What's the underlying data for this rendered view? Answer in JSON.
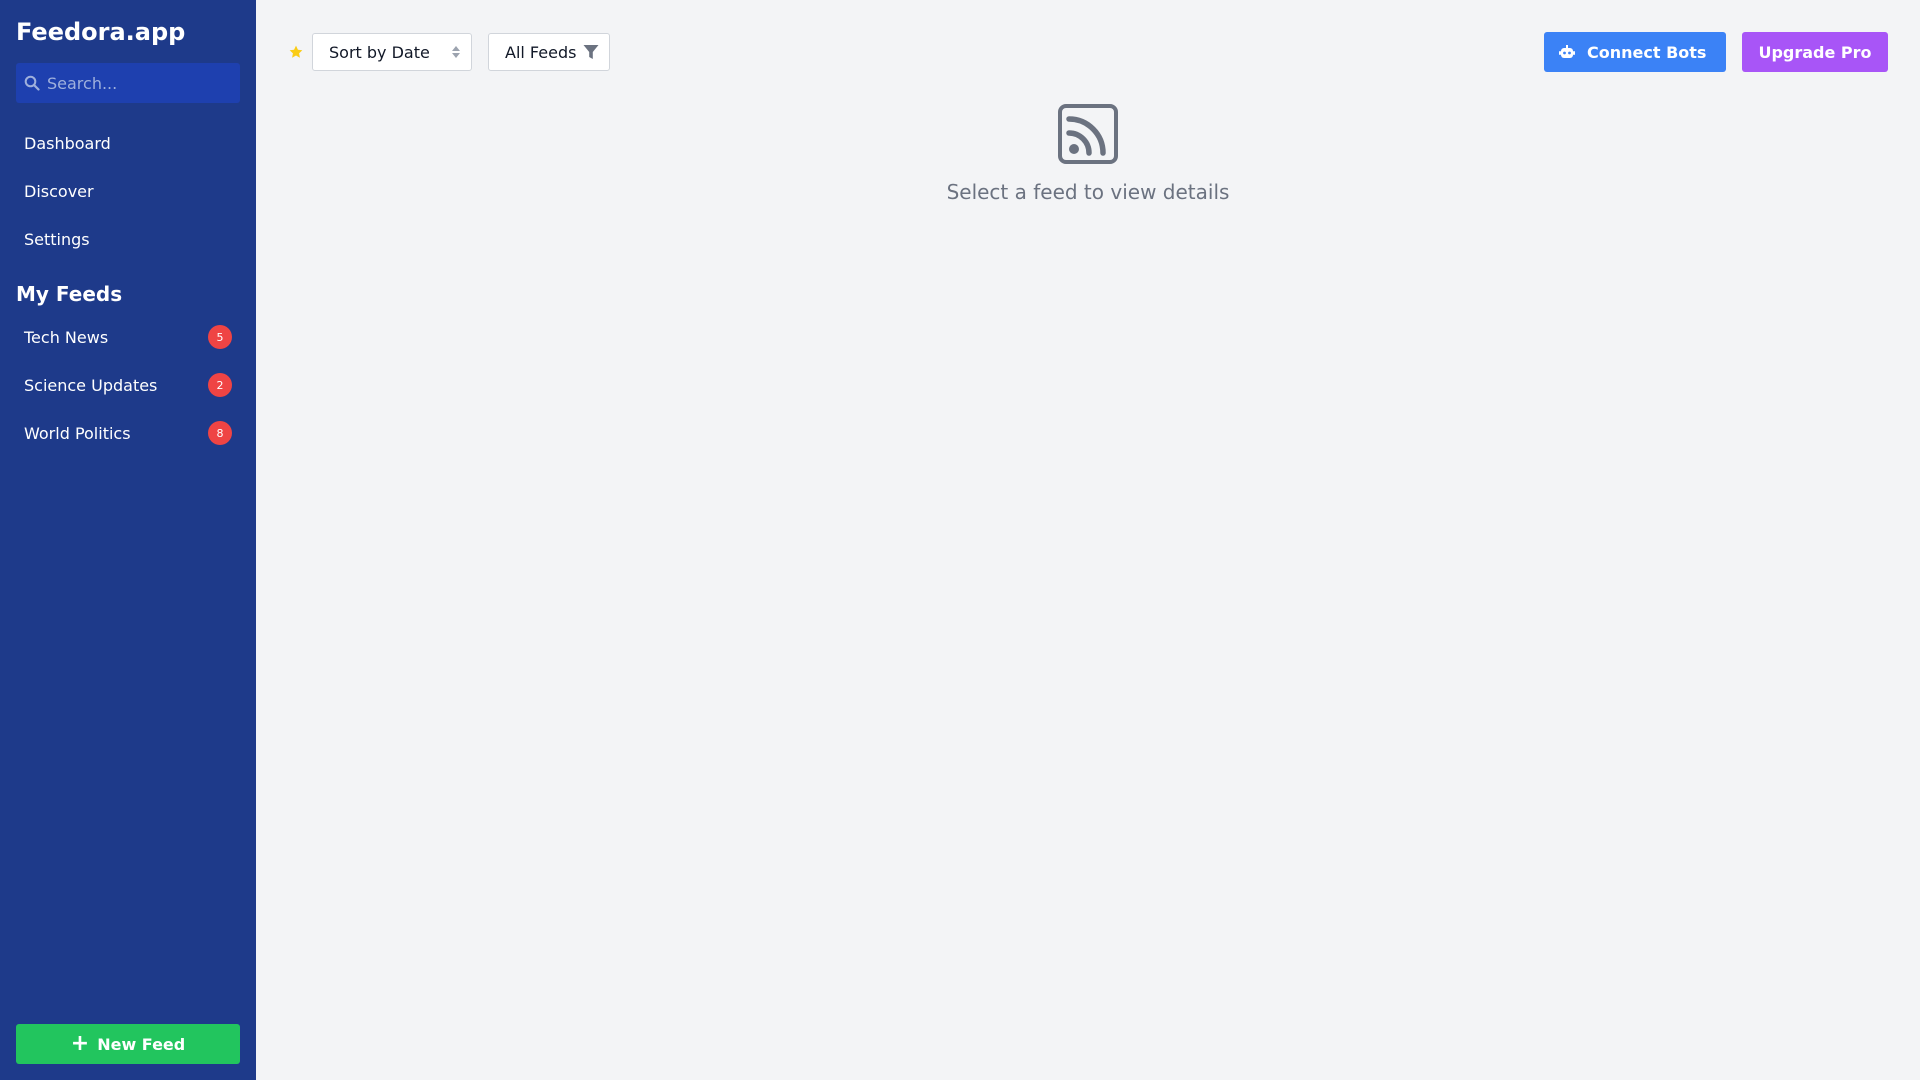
{
  "app": {
    "title": "Feedora.app"
  },
  "search": {
    "placeholder": "Search..."
  },
  "nav": {
    "items": [
      {
        "label": "Dashboard"
      },
      {
        "label": "Discover"
      },
      {
        "label": "Settings"
      }
    ]
  },
  "feeds": {
    "title": "My Feeds",
    "items": [
      {
        "label": "Tech News",
        "count": "5"
      },
      {
        "label": "Science Updates",
        "count": "2"
      },
      {
        "label": "World Politics",
        "count": "8"
      }
    ]
  },
  "sidebar_actions": {
    "new_feed": "New Feed"
  },
  "toolbar": {
    "sort_value": "Sort by Date",
    "filter_value": "All Feeds",
    "connect_bots": "Connect Bots",
    "upgrade_pro": "Upgrade Pro"
  },
  "empty_state": {
    "message": "Select a feed to view details"
  },
  "icons": {
    "search": "search-icon",
    "star": "star-icon",
    "sort": "sort-icon",
    "filter": "filter-icon",
    "robot": "robot-icon",
    "rss": "rss-icon",
    "plus": "plus-icon"
  },
  "colors": {
    "sidebar": "#1e3a8a",
    "search_bg": "#1e40af",
    "badge": "#ef4444",
    "new_feed": "#22c55e",
    "connect_bots": "#3b82f6",
    "upgrade_pro": "#a855f7",
    "star": "#facc15"
  }
}
